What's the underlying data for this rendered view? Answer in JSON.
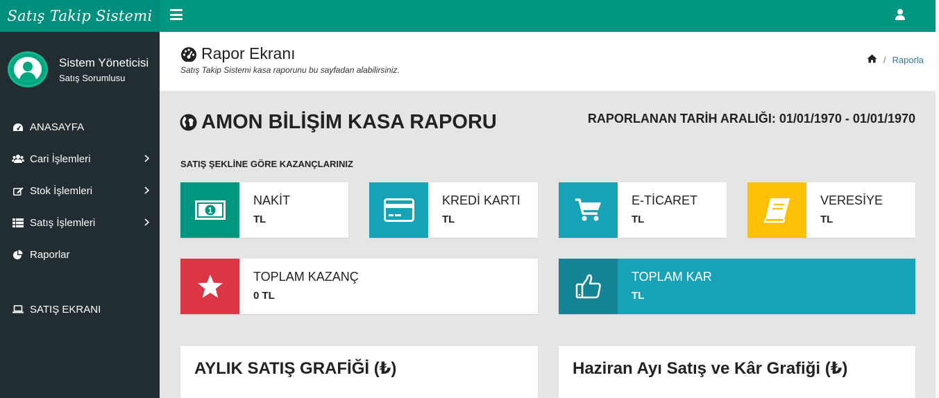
{
  "brand": {
    "title": "Satış Takip Sistemi"
  },
  "user": {
    "name": "Sistem Yöneticisi",
    "role": "Satış Sorumlusu"
  },
  "menu": {
    "items": [
      {
        "label": "ANASAYFA",
        "icon": "dashboard-icon",
        "has_submenu": false
      },
      {
        "label": "Cari İşlemleri",
        "icon": "users-icon",
        "has_submenu": true
      },
      {
        "label": "Stok İşlemleri",
        "icon": "edit-icon",
        "has_submenu": true
      },
      {
        "label": "Satış İşlemleri",
        "icon": "list-icon",
        "has_submenu": true
      },
      {
        "label": "Raporlar",
        "icon": "pie-chart-icon",
        "has_submenu": false
      }
    ],
    "sales_screen": {
      "label": "SATIŞ EKRANI",
      "icon": "laptop-icon"
    }
  },
  "header": {
    "title": "Rapor Ekranı",
    "subtitle": "Satış Takip Sistemi kasa raporunu bu sayfadan alabilirsiniz.",
    "breadcrumb": {
      "separator": "/",
      "current": "Raporla"
    }
  },
  "report": {
    "title": "AMON BİLİŞİM KASA RAPORU",
    "date_range": "RAPORLANAN TARİH ARALIĞI: 01/01/1970 - 01/01/1970",
    "section_label": "SATIŞ ŞEKLİNE GÖRE KAZANÇLARINIZ"
  },
  "boxes": [
    {
      "label": "NAKİT",
      "value": "TL",
      "icon": "money-icon",
      "color": "#00957f"
    },
    {
      "label": "KREDİ KARTI",
      "value": "TL",
      "icon": "credit-card-icon",
      "color": "#17a2b8"
    },
    {
      "label": "E-TİCARET",
      "value": "TL",
      "icon": "cart-icon",
      "color": "#17a2b8"
    },
    {
      "label": "VERESİYE",
      "value": "TL",
      "icon": "book-icon",
      "color": "#ffc107"
    }
  ],
  "totals": [
    {
      "label": "TOPLAM KAZANÇ",
      "value": "0 TL",
      "icon": "star-icon",
      "color": "#dc3545"
    },
    {
      "label": "TOPLAM KAR",
      "value": "TL",
      "icon": "thumbs-up-icon",
      "color": "#17a2b8"
    }
  ],
  "panels": [
    {
      "title": "AYLIK SATIŞ GRAFİĞİ (₺)"
    },
    {
      "title": "Haziran Ayı Satış ve Kâr Grafiği (₺)"
    }
  ],
  "colors": {
    "brand": "#008e7d",
    "topbar": "#00967f",
    "sidebar": "#222d32",
    "breadcrumb_link": "#337a93"
  }
}
